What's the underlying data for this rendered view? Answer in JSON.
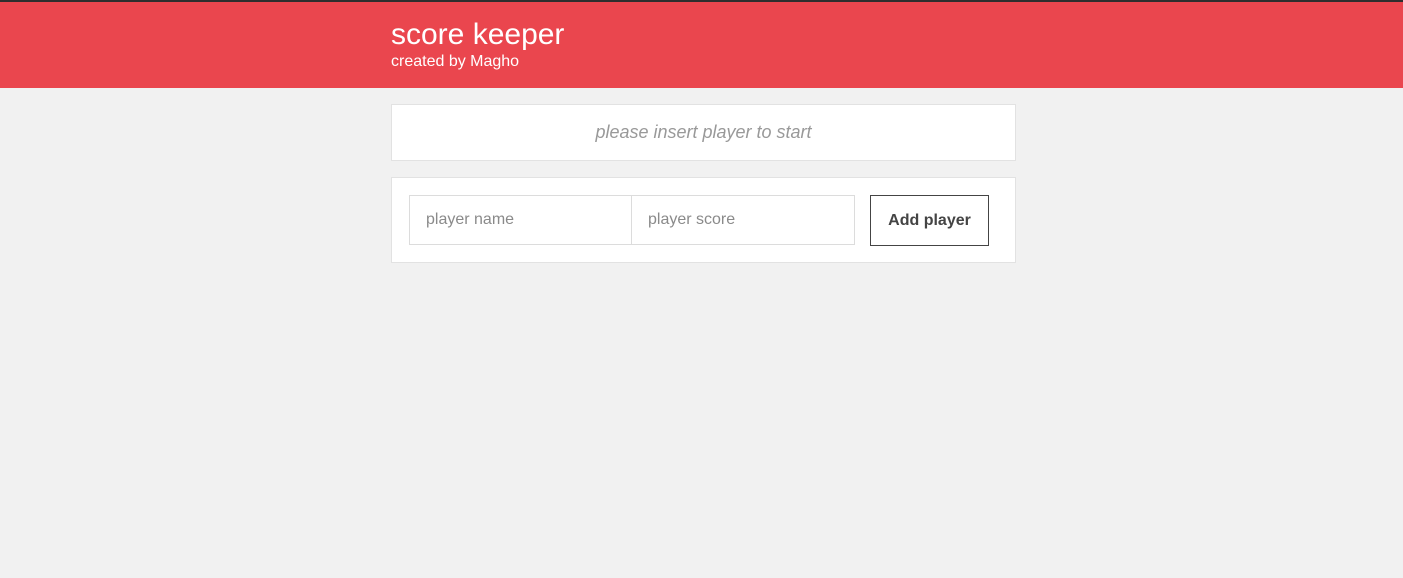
{
  "header": {
    "title": "score keeper",
    "subtitle": "created by Magho"
  },
  "message": {
    "text": "please insert player to start"
  },
  "form": {
    "name_placeholder": "player name",
    "name_value": "",
    "score_placeholder": "player score",
    "score_value": "",
    "add_label": "Add player"
  },
  "colors": {
    "header_bg": "#ea464e",
    "page_bg": "#f1f1f1",
    "panel_bg": "#ffffff",
    "message_text": "#999999"
  }
}
